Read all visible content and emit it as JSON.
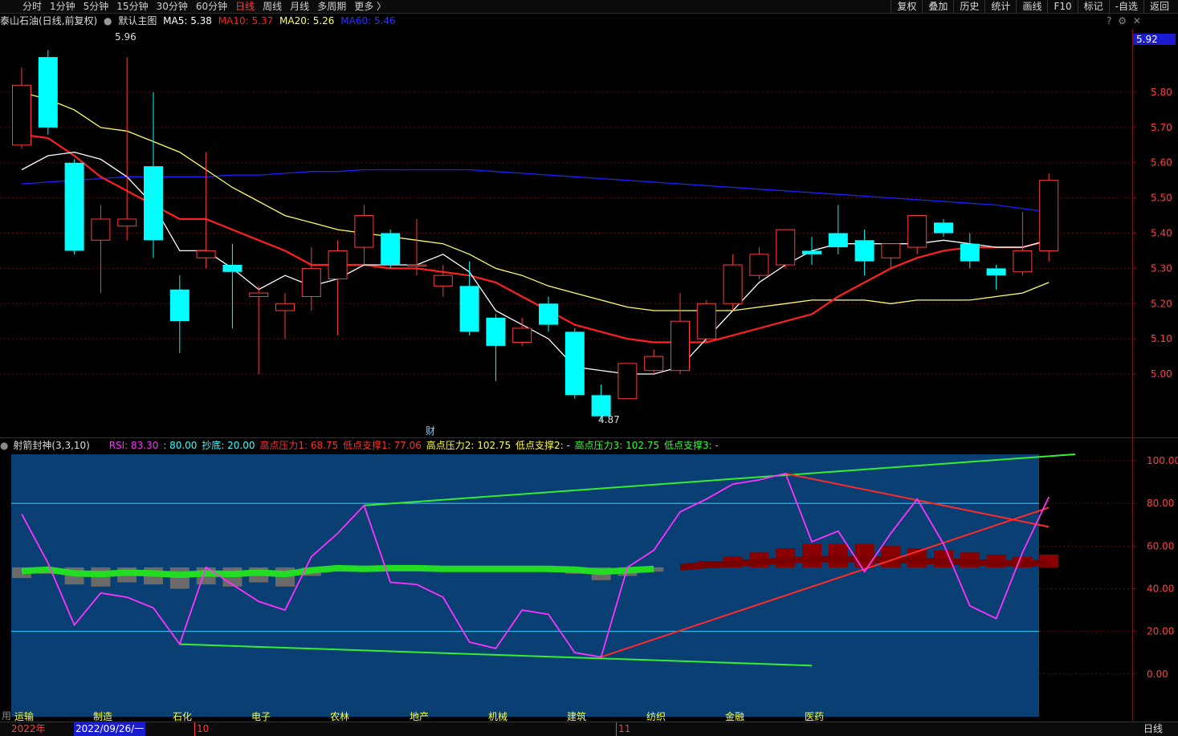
{
  "toolbar": {
    "periods": [
      "分时",
      "1分钟",
      "5分钟",
      "15分钟",
      "30分钟",
      "60分钟",
      "日线",
      "周线",
      "月线",
      "多周期",
      "更多 〉"
    ],
    "active_period": "日线",
    "tools": [
      "复权",
      "叠加",
      "历史",
      "统计",
      "画线",
      "F10",
      "标记",
      "-自选",
      "返回"
    ]
  },
  "header": {
    "stock": "泰山石油(日线,前复权)",
    "theme": "默认主图",
    "ma5": "MA5: 5.38",
    "ma10": "MA10: 5.37",
    "ma20": "MA20: 5.26",
    "ma60": "MA60: 5.46",
    "icons_right": [
      "question-icon",
      "gear-icon",
      "close-icon"
    ]
  },
  "price_tag": "5.92",
  "annotations": {
    "high": "5.96",
    "low": "4.87",
    "fin_marker": "财"
  },
  "indicator": {
    "name": "射箭封神(3,3,10)",
    "rsi": "RSI: 83.30",
    "rsi_val": ": 80.00",
    "chaodi": "抄底: 20.00",
    "high1": "高点压力1: 68.75",
    "low1": "低点支撑1: 77.06",
    "high2": "高点压力2: 102.75",
    "low2": "低点支撑2: -",
    "high3": "高点压力3: 102.75",
    "low3": "低点支撑3: -"
  },
  "sector_labels": [
    "运输",
    "制造",
    "石化",
    "电子",
    "农林",
    "地产",
    "机械",
    "建筑",
    "纺织",
    "金融",
    "医药"
  ],
  "bottom": {
    "year": "2022年",
    "date": "2022/09/26/一",
    "month10": "10",
    "month11": "11",
    "period": "日线",
    "left_char": "用"
  },
  "colors": {
    "up": "#ff3b3b",
    "down": "#00ffff",
    "ma5": "#ffffff",
    "ma10": "#ff2020",
    "ma20": "#ffff66",
    "ma60": "#2020ff",
    "rsi": "#ff33ff",
    "panel_bg": "#0a3f73"
  },
  "chart_data": [
    {
      "type": "candlestick",
      "title": "泰山石油(日线,前复权)",
      "y_ticks": [
        5.8,
        5.7,
        5.6,
        5.5,
        5.4,
        5.3,
        5.2,
        5.1,
        5.0
      ],
      "ylim": [
        4.82,
        5.98
      ],
      "candles": [
        {
          "o": 5.65,
          "c": 5.82,
          "h": 5.87,
          "l": 5.64
        },
        {
          "o": 5.9,
          "c": 5.7,
          "h": 5.92,
          "l": 5.68
        },
        {
          "o": 5.6,
          "c": 5.35,
          "h": 5.61,
          "l": 5.34
        },
        {
          "o": 5.38,
          "c": 5.44,
          "h": 5.48,
          "l": 5.23
        },
        {
          "o": 5.42,
          "c": 5.44,
          "h": 5.9,
          "l": 5.38
        },
        {
          "o": 5.59,
          "c": 5.38,
          "h": 5.8,
          "l": 5.33
        },
        {
          "o": 5.24,
          "c": 5.15,
          "h": 5.28,
          "l": 5.06
        },
        {
          "o": 5.33,
          "c": 5.35,
          "h": 5.63,
          "l": 5.3
        },
        {
          "o": 5.31,
          "c": 5.29,
          "h": 5.37,
          "l": 5.13
        },
        {
          "o": 5.22,
          "c": 5.23,
          "h": 5.25,
          "l": 5.0
        },
        {
          "o": 5.18,
          "c": 5.2,
          "h": 5.23,
          "l": 5.1
        },
        {
          "o": 5.22,
          "c": 5.3,
          "h": 5.36,
          "l": 5.18
        },
        {
          "o": 5.27,
          "c": 5.35,
          "h": 5.38,
          "l": 5.11
        },
        {
          "o": 5.36,
          "c": 5.45,
          "h": 5.48,
          "l": 5.31
        },
        {
          "o": 5.4,
          "c": 5.31,
          "h": 5.41,
          "l": 5.3
        },
        {
          "o": 5.31,
          "c": 5.31,
          "h": 5.44,
          "l": 5.28
        },
        {
          "o": 5.25,
          "c": 5.28,
          "h": 5.31,
          "l": 5.22
        },
        {
          "o": 5.25,
          "c": 5.12,
          "h": 5.32,
          "l": 5.11
        },
        {
          "o": 5.16,
          "c": 5.08,
          "h": 5.17,
          "l": 4.98
        },
        {
          "o": 5.09,
          "c": 5.13,
          "h": 5.16,
          "l": 5.08
        },
        {
          "o": 5.2,
          "c": 5.14,
          "h": 5.22,
          "l": 5.12
        },
        {
          "o": 5.12,
          "c": 4.94,
          "h": 5.13,
          "l": 4.93
        },
        {
          "o": 4.94,
          "c": 4.88,
          "h": 4.97,
          "l": 4.87
        },
        {
          "o": 4.93,
          "c": 5.03,
          "h": 5.03,
          "l": 4.93
        },
        {
          "o": 5.01,
          "c": 5.05,
          "h": 5.07,
          "l": 5.0
        },
        {
          "o": 5.01,
          "c": 5.15,
          "h": 5.23,
          "l": 5.0
        },
        {
          "o": 5.1,
          "c": 5.2,
          "h": 5.21,
          "l": 5.09
        },
        {
          "o": 5.2,
          "c": 5.31,
          "h": 5.34,
          "l": 5.18
        },
        {
          "o": 5.28,
          "c": 5.34,
          "h": 5.36,
          "l": 5.27
        },
        {
          "o": 5.31,
          "c": 5.41,
          "h": 5.41,
          "l": 5.3
        },
        {
          "o": 5.35,
          "c": 5.34,
          "h": 5.39,
          "l": 5.31
        },
        {
          "o": 5.4,
          "c": 5.36,
          "h": 5.48,
          "l": 5.34
        },
        {
          "o": 5.38,
          "c": 5.32,
          "h": 5.41,
          "l": 5.28
        },
        {
          "o": 5.33,
          "c": 5.37,
          "h": 5.37,
          "l": 5.3
        },
        {
          "o": 5.36,
          "c": 5.45,
          "h": 5.45,
          "l": 5.34
        },
        {
          "o": 5.43,
          "c": 5.4,
          "h": 5.44,
          "l": 5.39
        },
        {
          "o": 5.37,
          "c": 5.32,
          "h": 5.4,
          "l": 5.3
        },
        {
          "o": 5.3,
          "c": 5.28,
          "h": 5.31,
          "l": 5.24
        },
        {
          "o": 5.29,
          "c": 5.35,
          "h": 5.46,
          "l": 5.28
        },
        {
          "o": 5.35,
          "c": 5.55,
          "h": 5.57,
          "l": 5.32
        }
      ],
      "ma5": [
        5.58,
        5.62,
        5.63,
        5.61,
        5.56,
        5.48,
        5.35,
        5.35,
        5.3,
        5.24,
        5.28,
        5.25,
        5.27,
        5.31,
        5.31,
        5.31,
        5.34,
        5.29,
        5.18,
        5.14,
        5.1,
        5.02,
        5.01,
        5.0,
        5.0,
        5.02,
        5.1,
        5.18,
        5.26,
        5.31,
        5.35,
        5.37,
        5.37,
        5.37,
        5.37,
        5.38,
        5.37,
        5.36,
        5.36,
        5.38
      ],
      "ma10": [
        5.68,
        5.67,
        5.62,
        5.56,
        5.52,
        5.48,
        5.44,
        5.44,
        5.41,
        5.38,
        5.35,
        5.31,
        5.31,
        5.31,
        5.3,
        5.3,
        5.29,
        5.28,
        5.26,
        5.22,
        5.18,
        5.14,
        5.12,
        5.1,
        5.09,
        5.09,
        5.09,
        5.11,
        5.13,
        5.15,
        5.17,
        5.22,
        5.26,
        5.3,
        5.33,
        5.35,
        5.36,
        5.36,
        5.36,
        5.38
      ],
      "ma20": [
        5.8,
        5.78,
        5.75,
        5.7,
        5.69,
        5.66,
        5.63,
        5.58,
        5.53,
        5.49,
        5.45,
        5.43,
        5.41,
        5.4,
        5.39,
        5.38,
        5.37,
        5.34,
        5.3,
        5.28,
        5.25,
        5.23,
        5.21,
        5.19,
        5.18,
        5.18,
        5.18,
        5.18,
        5.19,
        5.2,
        5.21,
        5.21,
        5.21,
        5.2,
        5.21,
        5.21,
        5.21,
        5.22,
        5.23,
        5.26
      ],
      "ma60": [
        5.54,
        5.545,
        5.55,
        5.555,
        5.56,
        5.56,
        5.56,
        5.56,
        5.565,
        5.565,
        5.57,
        5.575,
        5.575,
        5.58,
        5.58,
        5.58,
        5.58,
        5.58,
        5.575,
        5.57,
        5.565,
        5.56,
        5.555,
        5.55,
        5.545,
        5.54,
        5.535,
        5.53,
        5.525,
        5.52,
        5.515,
        5.51,
        5.505,
        5.5,
        5.495,
        5.49,
        5.485,
        5.48,
        5.47,
        5.46
      ]
    },
    {
      "type": "line",
      "title": "射箭封神(3,3,10)",
      "y_ticks": [
        100.0,
        80.0,
        60.0,
        40.0,
        20.0,
        0.0
      ],
      "ylim": [
        -20,
        103
      ],
      "hlines": [
        80,
        20
      ],
      "rsi": [
        75,
        52,
        23,
        38,
        36,
        31,
        14,
        50,
        42,
        34,
        30,
        55,
        66,
        79,
        43,
        42,
        36,
        15,
        12,
        30,
        28,
        10,
        8,
        50,
        58,
        76,
        82,
        89,
        91,
        94,
        62,
        67,
        48,
        66,
        82,
        61,
        32,
        26,
        57,
        83
      ],
      "histogram": [
        -5,
        -3,
        -8,
        -9,
        -7,
        -8,
        -10,
        -8,
        -9,
        -7,
        -9,
        -4,
        -1,
        -2,
        -1,
        -1,
        -2,
        -2,
        -2,
        -2,
        -2,
        -3,
        -6,
        -4,
        -2,
        0,
        3,
        5,
        7,
        9,
        11,
        11,
        11,
        10,
        9,
        8,
        7,
        6,
        5,
        6
      ],
      "histogram_baseline": 50,
      "lines": [
        {
          "color": "green",
          "points": [
            [
              13,
              79
            ],
            [
              40,
              103
            ]
          ]
        },
        {
          "color": "green",
          "points": [
            [
              6,
              14
            ],
            [
              30,
              4
            ]
          ]
        },
        {
          "color": "red",
          "points": [
            [
              29,
              94
            ],
            [
              39,
              69
            ]
          ]
        },
        {
          "color": "red",
          "points": [
            [
              22,
              8
            ],
            [
              39,
              78
            ]
          ]
        }
      ]
    }
  ]
}
